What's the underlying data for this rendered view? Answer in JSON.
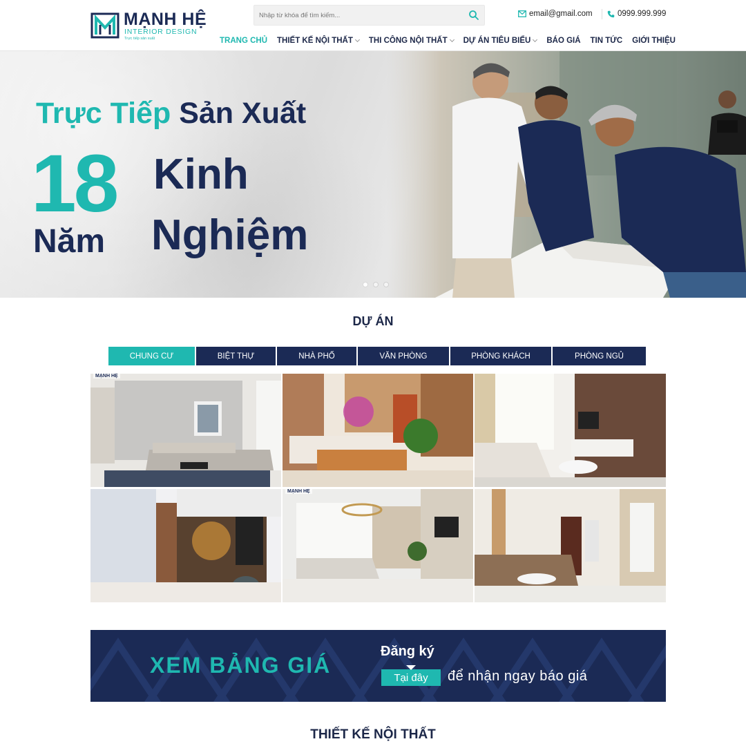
{
  "brand": {
    "name": "MẠNH HỆ",
    "subtitle": "INTERIOR DESIGN",
    "tagline": "Trực tiếp sản xuất"
  },
  "search": {
    "placeholder": "Nhập từ khóa để tìm kiếm..."
  },
  "contact": {
    "email": "email@gmail.com",
    "phone": "0999.999.999"
  },
  "nav": [
    {
      "label": "TRANG CHỦ",
      "active": true,
      "dropdown": false
    },
    {
      "label": "THIẾT KẾ NỘI THẤT",
      "active": false,
      "dropdown": true
    },
    {
      "label": "THI CÔNG NỘI THẤT",
      "active": false,
      "dropdown": true
    },
    {
      "label": "DỰ ÁN TIÊU BIỂU",
      "active": false,
      "dropdown": true
    },
    {
      "label": "BÁO GIÁ",
      "active": false,
      "dropdown": false
    },
    {
      "label": "TIN TỨC",
      "active": false,
      "dropdown": false
    },
    {
      "label": "GIỚI THIỆU",
      "active": false,
      "dropdown": false
    }
  ],
  "hero": {
    "line1_a": "Trực Tiếp",
    "line1_b": "Sản Xuất",
    "number": "18",
    "kinh": "Kinh",
    "nam": "Năm",
    "nghiem": "Nghiệm",
    "slides": 3,
    "active_slide": 1
  },
  "projects": {
    "title": "DỰ ÁN",
    "tabs": [
      {
        "label": "CHUNG CƯ",
        "active": true
      },
      {
        "label": "BIỆT THỰ",
        "active": false
      },
      {
        "label": "NHÀ PHỐ",
        "active": false
      },
      {
        "label": "VĂN PHÒNG",
        "active": false
      },
      {
        "label": "PHÒNG KHÁCH",
        "active": false
      },
      {
        "label": "PHÒNG NGỦ",
        "active": false
      }
    ],
    "tile_watermark": "MẠNH HỆ"
  },
  "banner": {
    "cta": "XEM BẢNG GIÁ",
    "register": "Đăng ký",
    "here": "Tại đây",
    "rest": "để nhận ngay báo giá"
  },
  "section2": {
    "title": "THIẾT KẾ NỘI THẤT"
  },
  "colors": {
    "teal": "#1fb8b0",
    "navy": "#1b2a55"
  }
}
